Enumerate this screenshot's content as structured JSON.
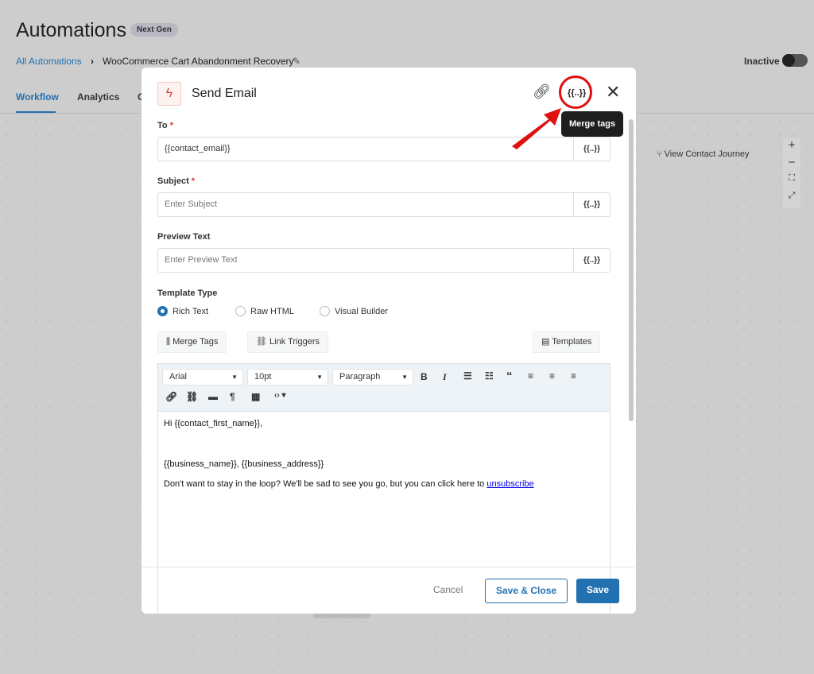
{
  "header": {
    "title": "Automations",
    "badge": "Next Gen",
    "breadcrumb_root": "All Automations",
    "breadcrumb_sep": "›",
    "breadcrumb_current": "WooCommerce Cart Abandonment Recovery",
    "status": "Inactive"
  },
  "tabs": [
    {
      "label": "Workflow",
      "active": true
    },
    {
      "label": "Analytics"
    },
    {
      "label": "C"
    }
  ],
  "canvas": {
    "view_journey": "View Contact Journey",
    "zoom_in": "+",
    "zoom_out": "−",
    "fit": "⛶",
    "expand": "⤢"
  },
  "modal": {
    "title": "Send Email",
    "merge_tag_glyph": "{{..}}",
    "tooltip": "Merge tags",
    "to": {
      "label": "To",
      "required": "*",
      "value": "{{contact_email}}"
    },
    "subject": {
      "label": "Subject",
      "required": "*",
      "placeholder": "Enter Subject"
    },
    "preview": {
      "label": "Preview Text",
      "placeholder": "Enter Preview Text"
    },
    "template_type": {
      "label": "Template Type",
      "options": [
        "Rich Text",
        "Raw HTML",
        "Visual Builder"
      ],
      "selected": "Rich Text"
    },
    "buttons": {
      "merge_tags": "Merge Tags",
      "link_triggers": "Link Triggers",
      "templates": "Templates"
    },
    "toolbar": {
      "font": "Arial",
      "size": "10pt",
      "format": "Paragraph"
    },
    "body": {
      "greeting": "Hi {{contact_first_name}},",
      "address": "{{business_name}}, {{business_address}}",
      "footer_text": "Don't want to stay in the loop? We'll be sad to see you go, but you can click here to ",
      "unsubscribe": "unsubscribe"
    },
    "footer": {
      "cancel": "Cancel",
      "save_close": "Save & Close",
      "save": "Save"
    }
  },
  "colors": {
    "accent": "#2271b1",
    "highlight": "#e01010"
  }
}
